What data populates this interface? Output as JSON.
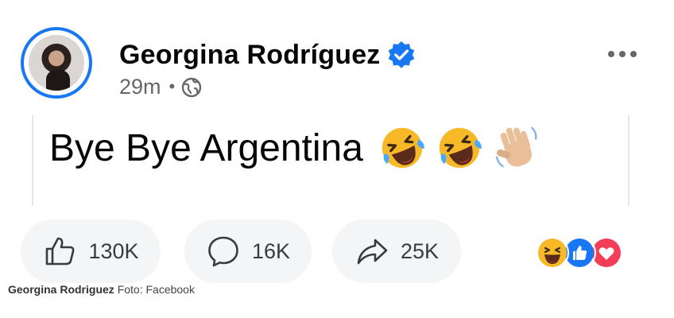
{
  "post": {
    "author": "Georgina Rodríguez",
    "timestamp": "29m",
    "separator": "•",
    "text": "Bye Bye Argentina",
    "emojis": [
      "rolling-laughing-emoji",
      "rolling-laughing-emoji",
      "waving-hand-emoji"
    ]
  },
  "actions": {
    "likes": "130K",
    "comments": "16K",
    "shares": "25K"
  },
  "reactions": [
    "haha-reaction",
    "like-reaction",
    "love-reaction"
  ],
  "caption": {
    "name": "Georgina Rodriguez",
    "credit": "Foto: Facebook"
  },
  "colors": {
    "brand": "#1877f2",
    "love": "#f33e58",
    "haha": "#f7b928",
    "muted": "#65676b",
    "action_bg": "#f4f5f7"
  }
}
